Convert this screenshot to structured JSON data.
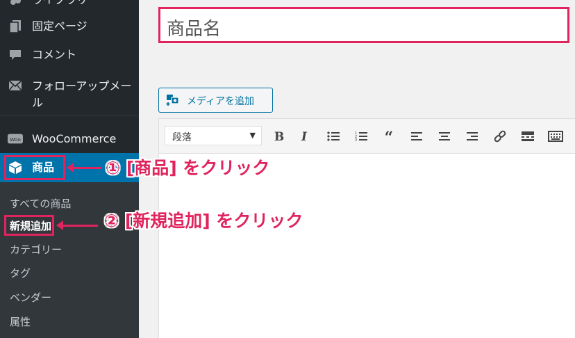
{
  "sidebar": {
    "top_item": "ライブラリ",
    "pages": "固定ページ",
    "comments": "コメント",
    "follow_mail": "フォローアップメール",
    "woocommerce": "WooCommerce",
    "woo_badge": "Woo",
    "products": "商品",
    "submenu": {
      "all_products": "すべての商品",
      "add_new": "新規追加",
      "categories": "カテゴリー",
      "tags": "タグ",
      "vendors": "ベンダー",
      "attributes": "属性"
    }
  },
  "editor": {
    "title_placeholder": "商品名",
    "media_button": "メディアを追加",
    "format_select": "段落"
  },
  "annotations": {
    "step1": "① [商品] をクリック",
    "step2": "② [新規追加] をクリック"
  },
  "colors": {
    "sidebar_bg": "#23282d",
    "submenu_bg": "#32373c",
    "active_bg": "#0073aa",
    "highlight": "#e0245e",
    "link": "#0071a1"
  },
  "icons": {
    "pages": "pages-icon",
    "comments": "comment-icon",
    "mail": "mail-icon",
    "woo": "woo-icon",
    "products": "box-icon"
  }
}
